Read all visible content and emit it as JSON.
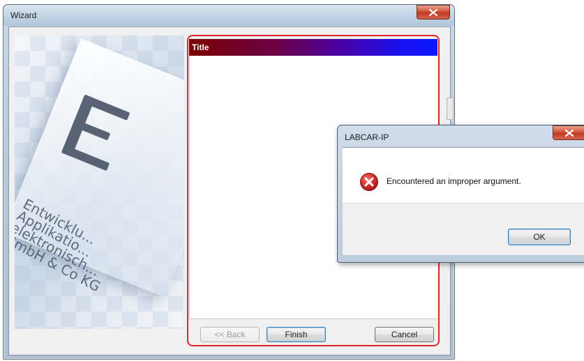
{
  "wizard": {
    "title": "Wizard",
    "page_title": "Title",
    "banner_text": [
      "Entwicklu...",
      "Applikatio...",
      "elektronisch...",
      "GmbH & Co KG"
    ],
    "buttons": {
      "back": "<< Back",
      "finish": "Finish",
      "cancel": "Cancel"
    }
  },
  "message_box": {
    "title": "LABCAR-IP",
    "message": "Encountered an improper argument.",
    "ok_label": "OK",
    "icon": "error-icon"
  },
  "colors": {
    "highlight_border": "#e0252b",
    "title_gradient_start": "#7b0000",
    "title_gradient_end": "#0a18ff",
    "close_button": "#c03a22",
    "error_icon": "#d32f2f"
  }
}
